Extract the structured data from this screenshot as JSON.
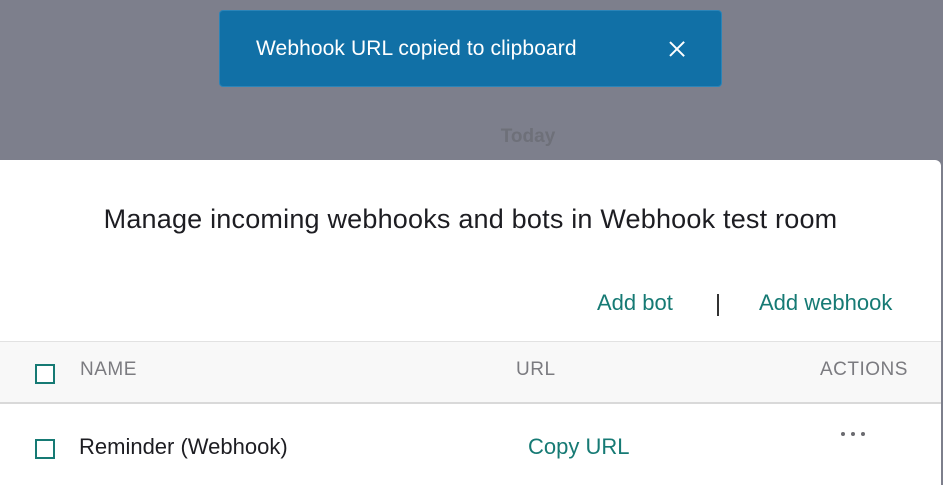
{
  "background": {
    "day_label": "Today"
  },
  "toast": {
    "message": "Webhook URL copied to clipboard",
    "close_icon": "close-icon",
    "color": "#1170a6"
  },
  "modal": {
    "title": "Manage incoming webhooks and bots in Webhook test room",
    "actions": {
      "add_bot": "Add bot",
      "separator": "|",
      "add_webhook": "Add webhook"
    },
    "table": {
      "columns": [
        "NAME",
        "URL",
        "ACTIONS"
      ],
      "rows": [
        {
          "name": "Reminder (Webhook)",
          "url_action": "Copy URL",
          "more_icon": "more-horizontal-icon"
        }
      ]
    },
    "accent_color": "#167a74"
  }
}
